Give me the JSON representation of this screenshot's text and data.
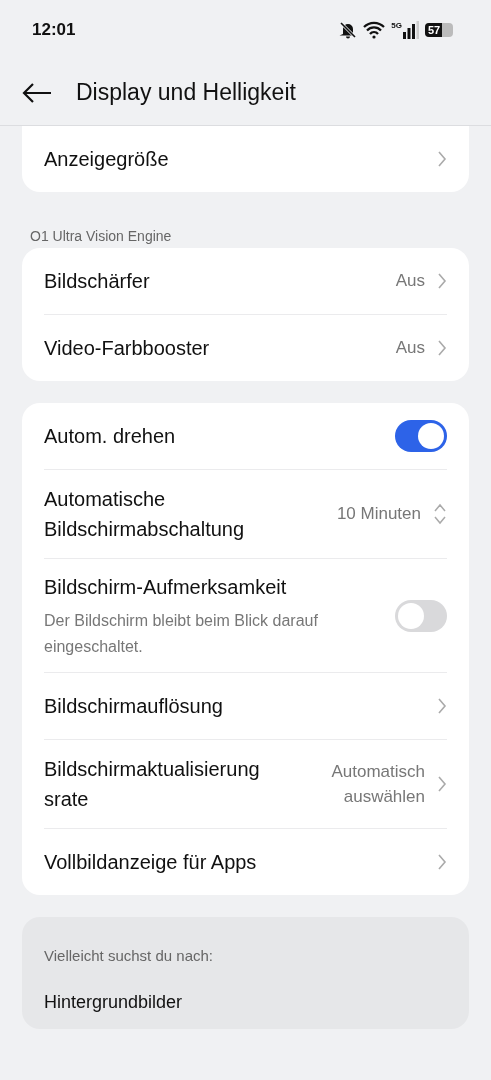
{
  "status_bar": {
    "time": "12:01",
    "network": "5G",
    "battery": "57"
  },
  "header": {
    "title": "Display und Helligkeit"
  },
  "groups": [
    {
      "rows": [
        {
          "kind": "link",
          "label": "Anzeigegröße"
        }
      ]
    },
    {
      "title": "O1 Ultra Vision Engine",
      "rows": [
        {
          "kind": "link",
          "label": "Bildschärfer",
          "value": "Aus"
        },
        {
          "kind": "link",
          "label": "Video-Farbbooster",
          "value": "Aus"
        }
      ]
    },
    {
      "rows": [
        {
          "kind": "toggle",
          "label": "Autom. drehen",
          "on": true
        },
        {
          "kind": "stepper",
          "label": "Automatische Bildschirmabschaltung",
          "value": "10 Minuten"
        },
        {
          "kind": "toggle",
          "label": "Bildschirm-Aufmerksamkeit",
          "description": "Der Bildschirm bleibt beim Blick darauf eingeschaltet.",
          "on": false
        },
        {
          "kind": "link",
          "label": "Bildschirmauflösung"
        },
        {
          "kind": "link",
          "label": "Bildschirmaktualisierung srate",
          "value": "Automatisch auswählen"
        },
        {
          "kind": "link",
          "label": "Vollbildanzeige für Apps"
        }
      ]
    }
  ],
  "suggestions": {
    "title": "Vielleicht suchst du nach:",
    "items": [
      "Hintergrundbilder"
    ]
  }
}
